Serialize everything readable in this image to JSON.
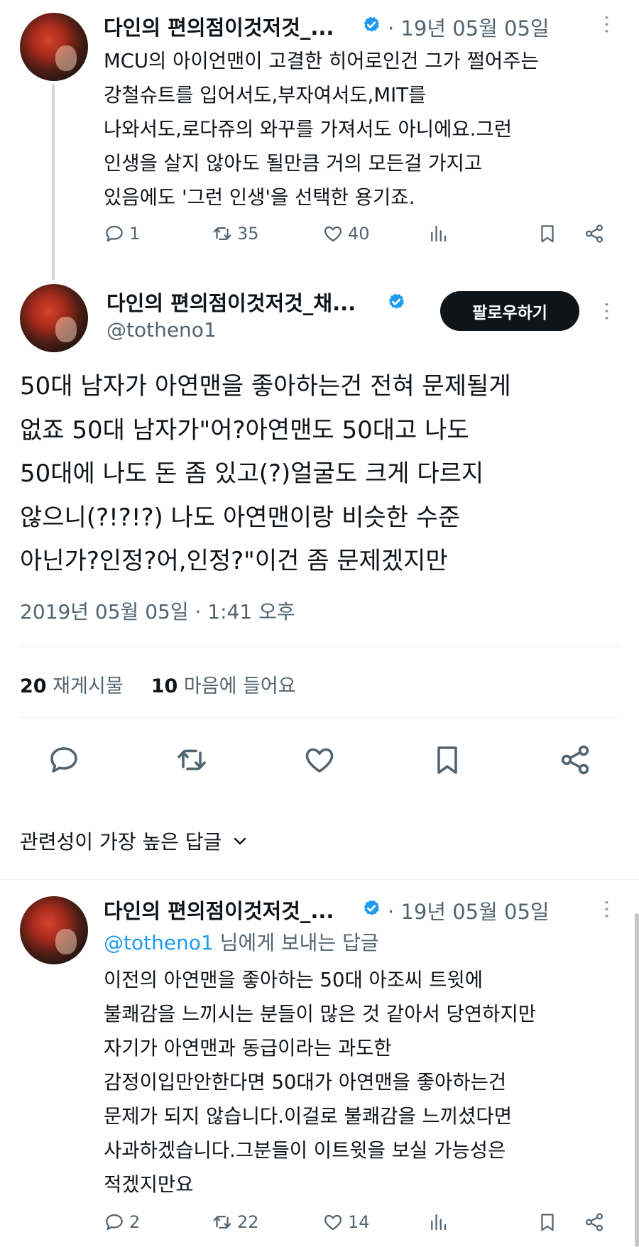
{
  "tweet1": {
    "display_name": "다인의 편의점이것저것_...",
    "date": "· 19년 05월 05일",
    "lines": [
      "MCU의 아이언맨이 고결한 히어로인건 그가 쩔어주는",
      "강철슈트를 입어서도,부자여서도,MIT를",
      "나와서도,로다쥬의 와꾸를 가져서도 아니에요.그런",
      "인생을 살지 않아도 될만큼 거의 모든걸 가지고",
      "있음에도 '그런 인생'을 선택한 용기죠."
    ],
    "replies": "1",
    "retweets": "35",
    "likes": "40"
  },
  "main": {
    "display_name": "다인의 편의점이것저것_채...",
    "handle": "@totheno1",
    "follow_label": "팔로우하기",
    "lines": [
      "50대 남자가 아연맨을 좋아하는건 전혀 문제될게",
      "없죠 50대 남자가\"어?아연맨도 50대고 나도",
      "50대에 나도 돈 좀 있고(?)얼굴도 크게 다르지",
      "않으니(?!?!?) 나도 아연맨이랑 비슷한 수준",
      "아닌가?인정?어,인정?\"이건 좀 문제겠지만"
    ],
    "timestamp": "2019년 05월 05일 · 1:41 오후",
    "retweet_count": "20",
    "retweet_label": "재게시물",
    "like_count": "10",
    "like_label": "마음에 들어요"
  },
  "sort": {
    "label": "관련성이 가장 높은 답글"
  },
  "reply": {
    "display_name": "다인의 편의점이것저것_...",
    "date": "· 19년 05월 05일",
    "reply_to_handle": "@totheno1",
    "reply_to_suffix": "님에게 보내는 답글",
    "lines": [
      "이전의 아연맨을 좋아하는 50대 아조씨 트윗에",
      "불쾌감을 느끼시는 분들이 많은 것 같아서 당연하지만",
      "자기가 아연맨과 동급이라는 과도한",
      "감정이입만안한다면 50대가 아연맨을 좋아하는건",
      "문제가 되지 않습니다.이걸로 불쾌감을 느끼셨다면",
      "사과하겠습니다.그분들이 이트윗을 보실 가능성은",
      "적겠지만요"
    ],
    "replies": "2",
    "retweets": "22",
    "likes": "14"
  },
  "icons": {
    "verified": "verified-badge-icon",
    "reply": "reply-icon",
    "retweet": "retweet-icon",
    "like": "heart-icon",
    "views": "views-icon",
    "bookmark": "bookmark-icon",
    "share": "share-icon",
    "more": "more-icon"
  },
  "colors": {
    "verified": "#1d9bf0",
    "link": "#1d9bf0",
    "muted": "#536471",
    "text": "#0f1419"
  }
}
